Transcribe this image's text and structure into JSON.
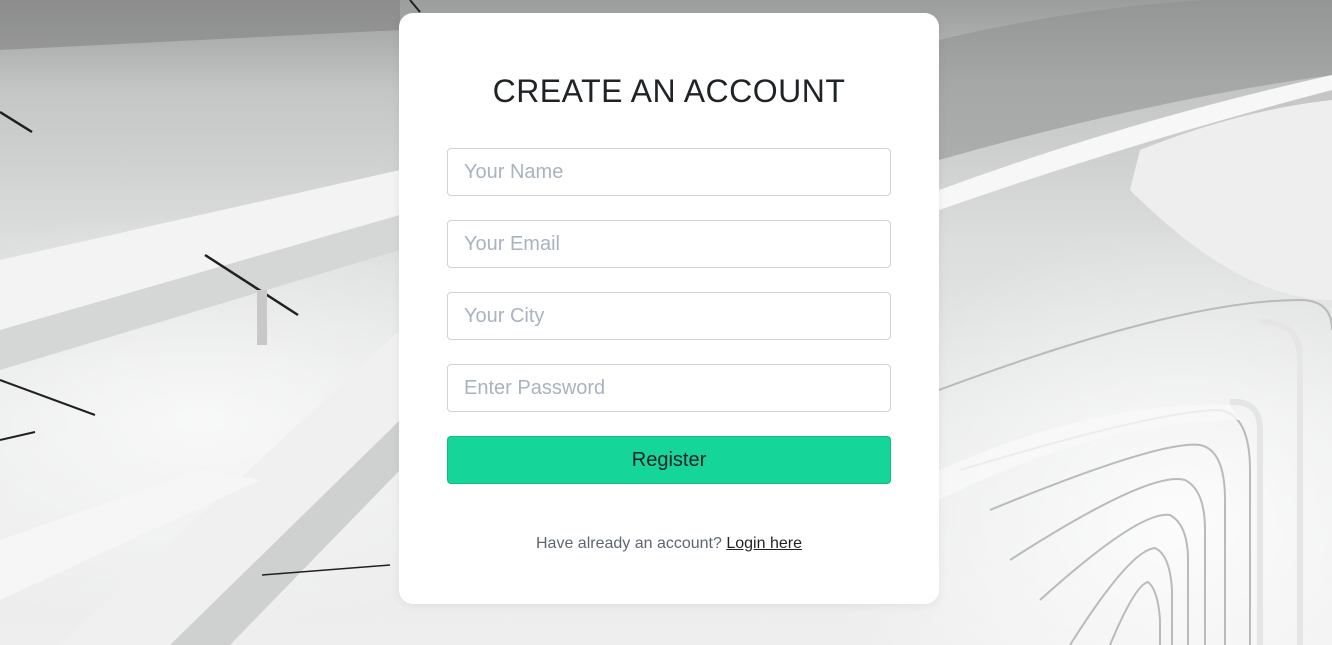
{
  "form": {
    "title": "CREATE AN ACCOUNT",
    "name_placeholder": "Your Name",
    "email_placeholder": "Your Email",
    "city_placeholder": "Your City",
    "password_placeholder": "Enter Password",
    "name_value": "",
    "email_value": "",
    "city_value": "",
    "password_value": "",
    "register_label": "Register",
    "footer_text": "Have already an account?",
    "login_link": "Login here"
  },
  "colors": {
    "button": "#16d598",
    "card": "#ffffff",
    "title": "#1f2326"
  }
}
